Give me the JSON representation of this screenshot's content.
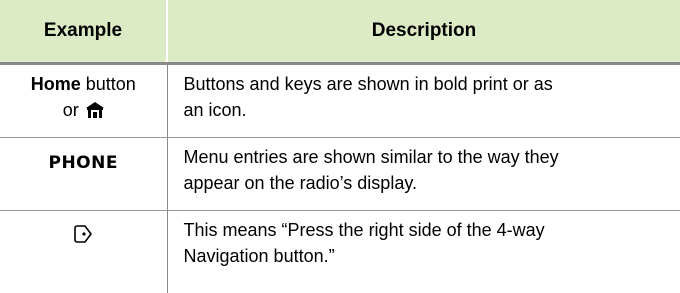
{
  "table": {
    "headers": {
      "example": "Example",
      "description": "Description"
    },
    "rows": [
      {
        "example_bold": "Home",
        "example_text": " button",
        "example_line2": "or",
        "description_line1": "Buttons and keys are shown in bold print or as",
        "description_line2": "an icon.",
        "icon": "home-icon"
      },
      {
        "example_label": "PHONE",
        "description_line1": "Menu entries are shown similar to the way they",
        "description_line2": "appear on the radio’s display."
      },
      {
        "icon": "nav-right-icon",
        "description_line1": "This means “Press the right side of the 4-way",
        "description_line2": "Navigation button.”"
      }
    ]
  },
  "colors": {
    "header_background": "#dcebc6",
    "rule": "#8a8a8a"
  }
}
